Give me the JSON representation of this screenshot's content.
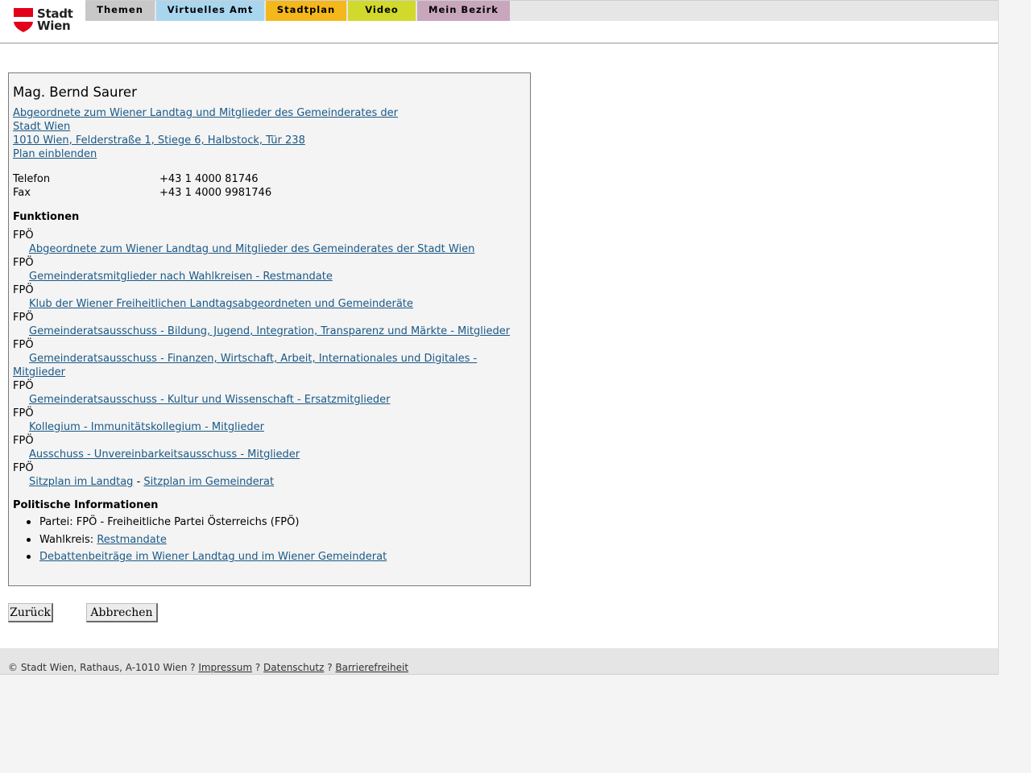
{
  "header": {
    "logo_text_line1": "Stadt",
    "logo_text_line2": "Wien",
    "logo_icon": "vienna-shield-icon",
    "brand_color": "#e2001a",
    "tabs": [
      {
        "label": "Themen",
        "color": "#c8c8c8"
      },
      {
        "label": "Virtuelles Amt",
        "color": "#a9d6ef"
      },
      {
        "label": "Stadtplan",
        "color": "#f5b81c"
      },
      {
        "label": "Video",
        "color": "#d1d92c"
      },
      {
        "label": "Mein Bezirk",
        "color": "#c8a7bd"
      }
    ]
  },
  "person": {
    "name": "Mag. Bernd Saurer",
    "org_line1": "Abgeordnete zum Wiener Landtag und Mitglieder des Gemeinderates der",
    "org_line2": "Stadt Wien ",
    "address": "1010 Wien, Felderstraße 1, Stiege 6, Halbstock, Tür 238",
    "plan_link": "Plan einblenden",
    "contacts": [
      {
        "label": "Telefon",
        "value": "+43 1 4000 81746"
      },
      {
        "label": "Fax",
        "value": "+43 1 4000 9981746"
      }
    ]
  },
  "functions": {
    "heading": "Funktionen",
    "party": "FPÖ",
    "items": [
      "Abgeordnete zum Wiener Landtag und Mitglieder des Gemeinderates der Stadt Wien",
      "Gemeinderatsmitglieder nach Wahlkreisen - Restmandate",
      "Klub der Wiener Freiheitlichen Landtagsabgeordneten und Gemeinderäte",
      "Gemeinderatsausschuss - Bildung, Jugend, Integration, Transparenz und Märkte - Mitglieder",
      "Gemeinderatsausschuss - Finanzen, Wirtschaft, Arbeit, Internationales und Digitales -",
      "Mitglieder",
      "Gemeinderatsausschuss - Kultur und Wissenschaft - Ersatzmitglieder",
      "Kollegium - Immunitätskollegium - Mitglieder",
      "Ausschuss - Unvereinbarkeitsausschuss - Mitglieder"
    ],
    "seat_landtag": "Sitzplan im Landtag",
    "seat_separator": "-",
    "seat_gemeinderat": "Sitzplan im Gemeinderat"
  },
  "political": {
    "heading": "Politische Informationen",
    "party_line": "Partei: FPÖ - Freiheitliche Partei Österreichs (FPÖ)",
    "wahlkreis_label": "Wahlkreis: ",
    "wahlkreis_link": "Restmandate",
    "debates_link": "Debattenbeiträge im Wiener Landtag und im Wiener Gemeinderat"
  },
  "buttons": {
    "back": "Zurück",
    "cancel": "Abbrechen"
  },
  "footer": {
    "copyright": "© Stadt Wien, Rathaus, A-1010 Wien ? ",
    "impressum": "Impressum",
    "sep1": " ? ",
    "datenschutz": "Datenschutz",
    "sep2": " ? ",
    "barrierefreiheit": "Barrierefreiheit"
  }
}
